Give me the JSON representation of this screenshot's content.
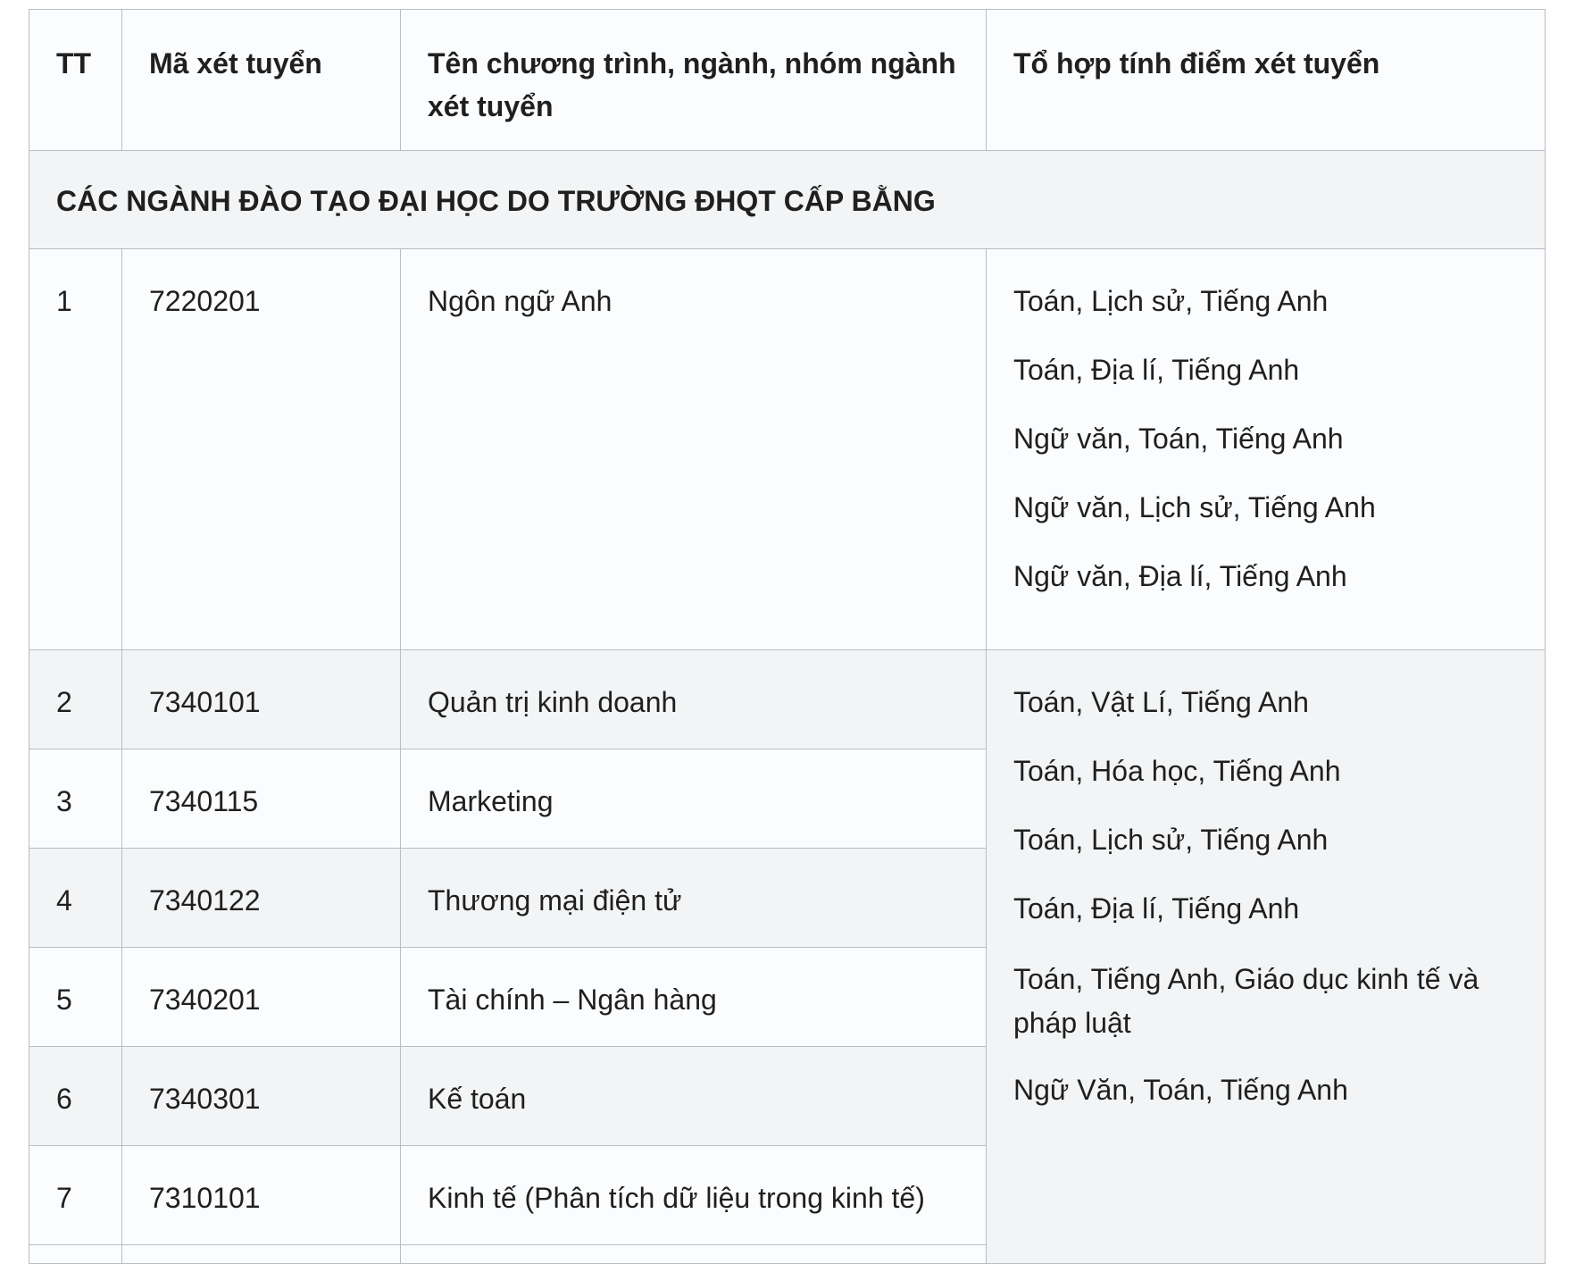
{
  "header": {
    "tt": "TT",
    "code": "Mã xét tuyển",
    "program": "Tên chương trình, ngành, nhóm ngành xét tuyển",
    "combination": "Tổ hợp tính điểm xét tuyển"
  },
  "section": {
    "title": "CÁC NGÀNH ĐÀO TẠO ĐẠI HỌC DO TRƯỜNG ĐHQT CẤP BẰNG"
  },
  "group1": {
    "rows": [
      {
        "tt": "1",
        "code": "7220201",
        "program": "Ngôn ngữ Anh"
      }
    ],
    "combinations": [
      "Toán, Lịch sử, Tiếng Anh",
      "Toán, Địa lí, Tiếng Anh",
      "Ngữ văn, Toán, Tiếng Anh",
      "Ngữ văn, Lịch sử, Tiếng Anh",
      "Ngữ văn, Địa lí, Tiếng Anh"
    ]
  },
  "group2": {
    "rows": [
      {
        "tt": "2",
        "code": "7340101",
        "program": "Quản trị kinh doanh"
      },
      {
        "tt": "3",
        "code": "7340115",
        "program": "Marketing"
      },
      {
        "tt": "4",
        "code": "7340122",
        "program": "Thương mại điện tử"
      },
      {
        "tt": "5",
        "code": "7340201",
        "program": "Tài chính – Ngân hàng"
      },
      {
        "tt": "6",
        "code": "7340301",
        "program": "Kế toán"
      },
      {
        "tt": "7",
        "code": "7310101",
        "program": "Kinh tế (Phân tích dữ liệu trong kinh tế)"
      }
    ],
    "combinations": [
      "Toán, Vật Lí, Tiếng Anh",
      "Toán, Hóa học, Tiếng Anh",
      "Toán, Lịch sử, Tiếng Anh",
      "Toán, Địa lí, Tiếng Anh",
      "Toán, Tiếng Anh, Giáo dục kinh tế và pháp luật",
      "Ngữ Văn, Toán, Tiếng Anh"
    ]
  }
}
